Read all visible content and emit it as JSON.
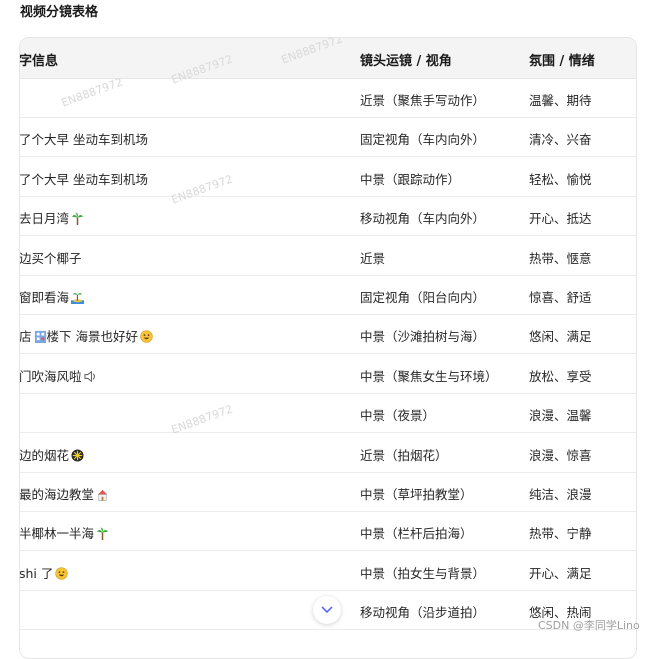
{
  "title": "视频分镜表格",
  "headers": [
    "字信息",
    "镜头运镜 / 视角",
    "氛围 / 情绪"
  ],
  "rows": [
    {
      "c1": "",
      "c2": "近景（聚焦手写动作）",
      "c3": "温馨、期待",
      "icon": ""
    },
    {
      "c1": "了个大早 坐动车到机场",
      "c2": "固定视角（车内向外）",
      "c3": "清冷、兴奋",
      "icon": ""
    },
    {
      "c1": "了个大早 坐动车到机场",
      "c2": "中景（跟踪动作）",
      "c3": "轻松、愉悦",
      "icon": ""
    },
    {
      "c1": "去日月湾",
      "c2": "移动视角（车内向外）",
      "c3": "开心、抵达",
      "icon": "palm-tree-icon"
    },
    {
      "c1": "边买个椰子",
      "c2": "近景",
      "c3": "热带、惬意",
      "icon": ""
    },
    {
      "c1": "窗即看海",
      "c2": "固定视角（阳台向内）",
      "c3": "惊喜、舒适",
      "icon": "island-icon"
    },
    {
      "c1": "店",
      "c1b": "楼下 海景也好好",
      "c2": "中景（沙滩拍树与海）",
      "c3": "悠闲、满足",
      "icon": "hotel-icon",
      "icon2": "smile-icon"
    },
    {
      "c1": "门吹海风啦",
      "c2": "中景（聚焦女生与环境）",
      "c3": "放松、享受",
      "icon": "speaker-icon"
    },
    {
      "c1": "",
      "c2": "中景（夜景）",
      "c3": "浪漫、温馨",
      "icon": ""
    },
    {
      "c1": "边的烟花",
      "c2": "近景（拍烟花）",
      "c3": "浪漫、惊喜",
      "icon": "firework-icon"
    },
    {
      "c1": "最的海边教堂",
      "c2": "中景（草坪拍教堂）",
      "c3": "纯洁、浪漫",
      "icon": "church-icon"
    },
    {
      "c1": "半椰林一半海",
      "c2": "中景（栏杆后拍海）",
      "c3": "热带、宁静",
      "icon": "palm-tree-icon"
    },
    {
      "c1": "shi 了",
      "c2": "中景（拍女生与背景）",
      "c3": "开心、满足",
      "icon": "smile-icon"
    },
    {
      "c1": "",
      "c2": "移动视角（沿步道拍）",
      "c3": "悠闲、热闹",
      "icon": ""
    }
  ],
  "watermark": "EN8887972",
  "credit": "CSDN @李同学Lino"
}
